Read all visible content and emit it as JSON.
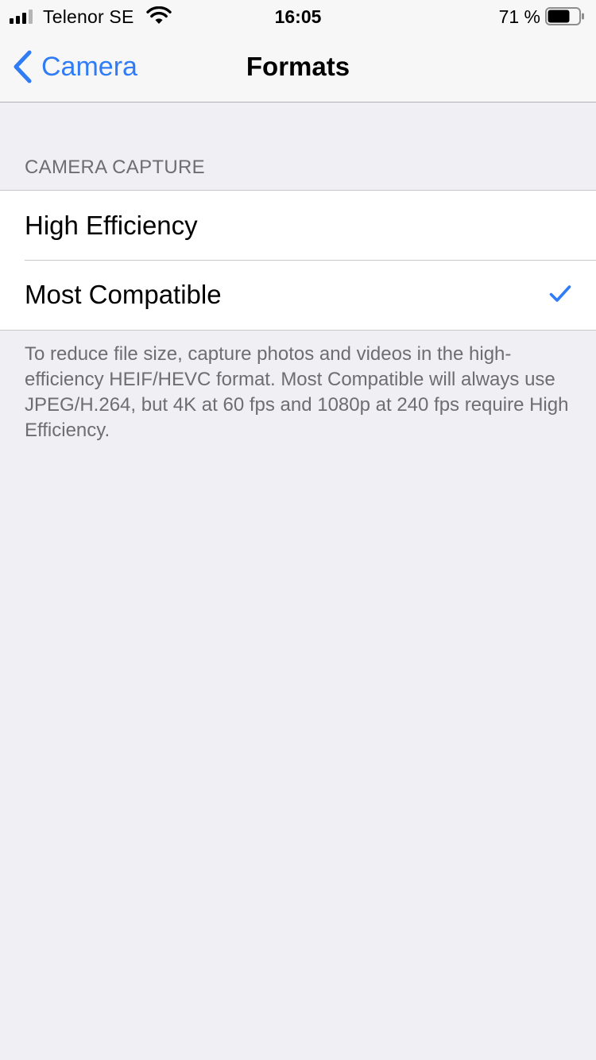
{
  "status_bar": {
    "carrier": "Telenor SE",
    "time": "16:05",
    "battery_percent": "71 %",
    "battery_level": 0.71,
    "signal_bars": 3,
    "signal_bars_total": 4
  },
  "nav": {
    "back_label": "Camera",
    "title": "Formats"
  },
  "section": {
    "header": "CAMERA CAPTURE",
    "options": [
      {
        "label": "High Efficiency",
        "selected": false
      },
      {
        "label": "Most Compatible",
        "selected": true
      }
    ],
    "footer": "To reduce file size, capture photos and videos in the high-efficiency HEIF/HEVC format. Most Compatible will always use JPEG/H.264, but 4K at 60 fps and 1080p at 240 fps require High Efficiency."
  },
  "colors": {
    "accent": "#2f7cf6",
    "background": "#efeff4",
    "secondary_text": "#6d6d72"
  },
  "icons": {
    "back": "chevron-left-icon",
    "check": "checkmark-icon",
    "wifi": "wifi-icon",
    "battery": "battery-icon",
    "signal": "cellular-signal-icon"
  }
}
